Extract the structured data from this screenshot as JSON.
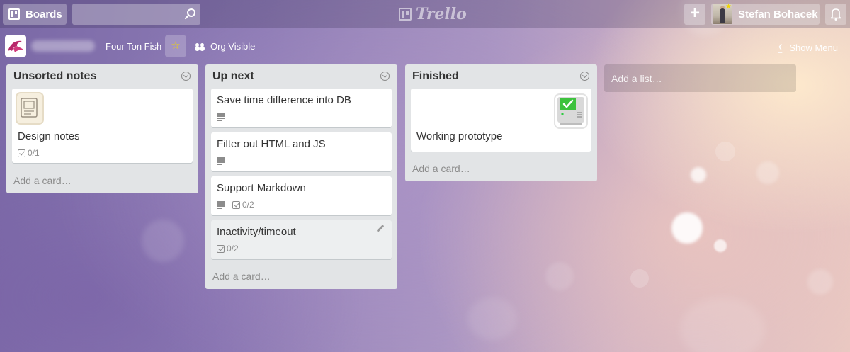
{
  "header": {
    "boards_label": "Boards",
    "search_value": "",
    "logo_text": "Trello",
    "user_name": "Stefan Bohacek"
  },
  "board": {
    "org_name": "Four Ton Fish",
    "visibility": "Org Visible",
    "show_menu_label": "Show Menu"
  },
  "lists": [
    {
      "title": "Unsorted notes",
      "cards": [
        {
          "title": "Design notes",
          "checklist": "0/1"
        }
      ],
      "add_card": "Add a card…"
    },
    {
      "title": "Up next",
      "cards": [
        {
          "title": "Save time difference into DB"
        },
        {
          "title": "Filter out HTML and JS"
        },
        {
          "title": "Support Markdown",
          "checklist": "0/2"
        },
        {
          "title": "Inactivity/timeout",
          "checklist": "0/2"
        }
      ],
      "add_card": "Add a card…"
    },
    {
      "title": "Finished",
      "cards": [
        {
          "title": "Working prototype"
        }
      ],
      "add_card": "Add a card…"
    }
  ],
  "add_list_label": "Add a list…",
  "colors": {
    "list_bg": "#e2e4e6",
    "star": "#f2d600",
    "check_green": "#2ecc40"
  },
  "icons": {
    "boards": "boards-icon",
    "search": "search-icon",
    "plus": "plus-icon",
    "bell": "bell-icon",
    "star": "star-icon",
    "visibility": "people-icon",
    "menu": "chevron-left-icon",
    "list_menu": "chevron-down-circle-icon",
    "description": "description-icon",
    "checklist": "checklist-icon",
    "edit": "pencil-icon"
  }
}
